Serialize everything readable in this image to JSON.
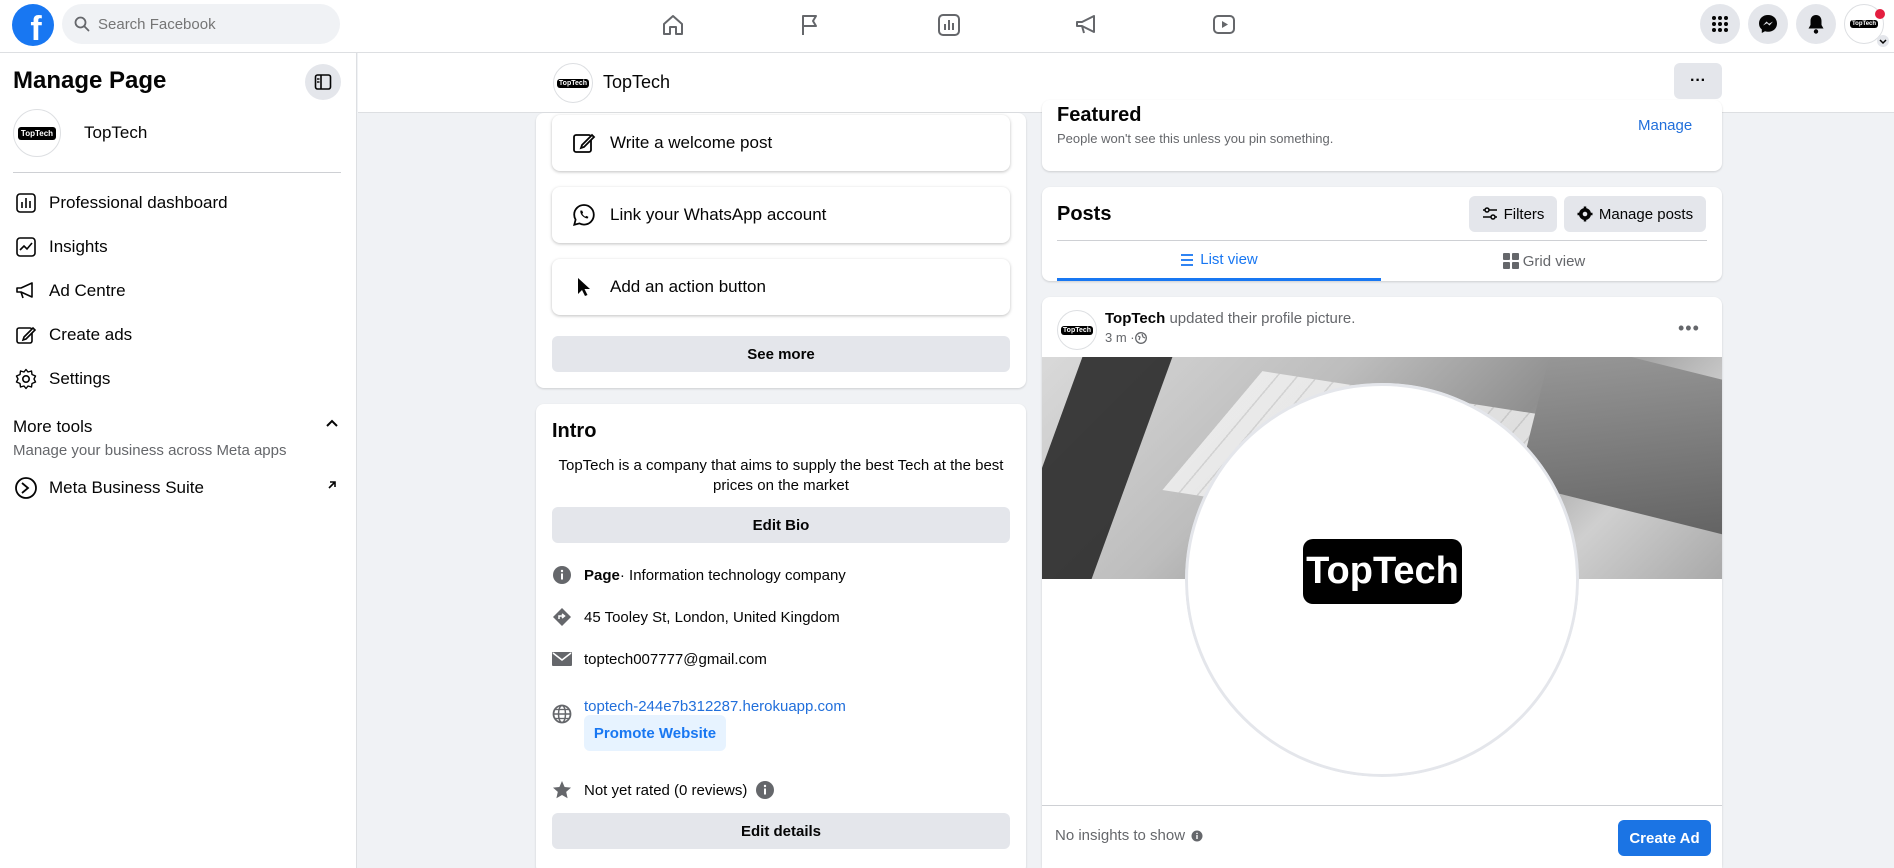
{
  "topbar": {
    "logo_letter": "f",
    "search_placeholder": "Search Facebook",
    "nav_icons": [
      "home-icon",
      "flag-icon",
      "chart-icon",
      "megaphone-icon",
      "video-icon"
    ],
    "right_icons": [
      "menu-grid-icon",
      "messenger-icon",
      "bell-icon",
      "account-avatar"
    ],
    "avatar_text": "TopTech"
  },
  "sidebar": {
    "title": "Manage Page",
    "page_name": "TopTech",
    "avatar_text": "TopTech",
    "items": [
      {
        "label": "Professional dashboard",
        "icon": "dashboard-icon"
      },
      {
        "label": "Insights",
        "icon": "insights-icon"
      },
      {
        "label": "Ad Centre",
        "icon": "megaphone-icon"
      },
      {
        "label": "Create ads",
        "icon": "pencil-icon"
      },
      {
        "label": "Settings",
        "icon": "gear-icon"
      }
    ],
    "more_tools_title": "More tools",
    "more_tools_sub": "Manage your business across Meta apps",
    "meta_suite_label": "Meta Business Suite"
  },
  "pagebar": {
    "name": "TopTech",
    "avatar_text": "TopTech",
    "more_label": "···"
  },
  "setup": {
    "actions": [
      {
        "label": "Write a welcome post",
        "icon": "edit-icon"
      },
      {
        "label": "Link your WhatsApp account",
        "icon": "whatsapp-icon"
      },
      {
        "label": "Add an action button",
        "icon": "cursor-icon"
      }
    ],
    "see_more": "See more"
  },
  "intro": {
    "title": "Intro",
    "bio": "TopTech is a company that aims to supply the best Tech at the best prices on the market",
    "edit_bio": "Edit Bio",
    "category_bold": "Page",
    "category_rest": " · Information technology company",
    "address": "45 Tooley St, London, United Kingdom",
    "email": "toptech007777@gmail.com",
    "website": "toptech-244e7b312287.herokuapp.com",
    "promote_website": "Promote Website",
    "rating": "Not yet rated (0 reviews)",
    "edit_details": "Edit details"
  },
  "featured": {
    "title": "Featured",
    "subtitle": "People won't see this unless you pin something.",
    "manage": "Manage"
  },
  "posts": {
    "title": "Posts",
    "filters": "Filters",
    "manage_posts": "Manage posts",
    "tab_list": "List view",
    "tab_grid": "Grid view",
    "post": {
      "author": "TopTech",
      "action": " updated their profile picture.",
      "time": "3 m · ",
      "avatar_text": "TopTech",
      "image_logo_text": "TopTech"
    },
    "no_insights": "No insights to show",
    "create_ad": "Create Ad"
  },
  "colors": {
    "brand": "#1877f2",
    "link": "#216fdb",
    "bg": "#f0f2f5"
  }
}
